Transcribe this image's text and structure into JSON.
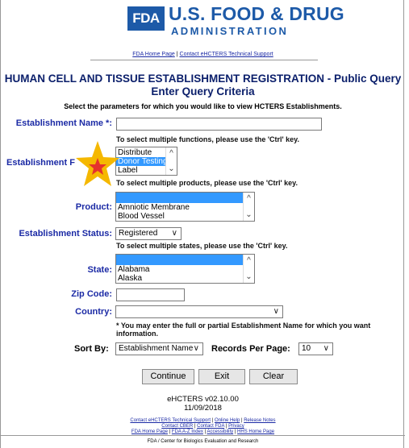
{
  "header": {
    "fda_box": "FDA",
    "logo_title": "U.S. FOOD & DRUG",
    "logo_sub": "ADMINISTRATION",
    "top_links": [
      "FDA Home Page",
      "Contact eHCTERS Technical Support"
    ],
    "separator": "|"
  },
  "page": {
    "title_line1": "HUMAN CELL AND TISSUE ESTABLISHMENT REGISTRATION - Public Query",
    "title_line2": "Enter Query Criteria",
    "instruction": "Select the parameters for which you would like to view HCTERS Establishments."
  },
  "form": {
    "establishment_name": {
      "label": "Establishment Name *:",
      "value": ""
    },
    "functions_hint": "To select multiple functions, please use the 'Ctrl' key.",
    "establishment_function": {
      "label": "Establishment F",
      "options": [
        "Distribute",
        "Donor Testing",
        "Label"
      ],
      "selected": "Donor Testing"
    },
    "products_hint": "To select multiple products, please use the 'Ctrl' key.",
    "product": {
      "label": "Product:",
      "options": [
        "",
        "Amniotic Membrane",
        "Blood Vessel"
      ]
    },
    "establishment_status": {
      "label": "Establishment Status:",
      "value": "Registered"
    },
    "states_hint": "To select multiple states, please use the 'Ctrl' key.",
    "state": {
      "label": "State:",
      "options": [
        "",
        "Alabama",
        "Alaska"
      ]
    },
    "zip_code": {
      "label": "Zip Code:",
      "value": ""
    },
    "country": {
      "label": "Country:",
      "value": ""
    },
    "name_note_line1": "* You may enter the full or partial Establishment Name for which you want",
    "name_note_line2": "information.",
    "sort_by": {
      "label": "Sort By:",
      "value": "Establishment Name"
    },
    "records_per_page": {
      "label": "Records Per Page:",
      "value": "10"
    }
  },
  "buttons": {
    "continue": "Continue",
    "exit": "Exit",
    "clear": "Clear"
  },
  "version": {
    "line1": "eHCTERS v02.10.00",
    "line2": "11/09/2018"
  },
  "footer": {
    "line1": [
      "Contact eHCTERS Technical Support",
      "Online Help",
      "Release Notes"
    ],
    "line2": [
      "Contact CBER",
      "Contact FDA",
      "Privacy"
    ],
    "line3": [
      "FDA Home Page",
      "FDA A-Z Index",
      "Accessibility",
      "HHS Home Page"
    ],
    "credit": "FDA / Center for Biologics Evaluation and Research"
  },
  "colors": {
    "brand": "#1d5aa8",
    "label": "#1b2aa5",
    "title": "#0b1f6b",
    "selection": "#3399ff",
    "star": "#f5b800"
  },
  "icons": {
    "star": "star-icon"
  }
}
